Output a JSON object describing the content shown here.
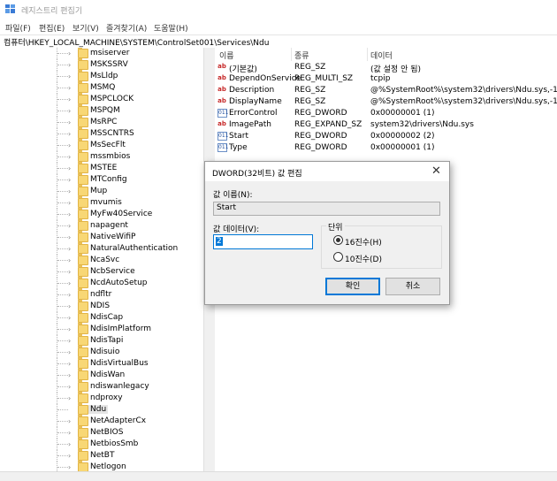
{
  "window": {
    "title": "레지스트리 편집기"
  },
  "menu": [
    "파일(F)",
    "편집(E)",
    "보기(V)",
    "즐겨찾기(A)",
    "도움말(H)"
  ],
  "address": "컴퓨터\\HKEY_LOCAL_MACHINE\\SYSTEM\\ControlSet001\\Services\\Ndu",
  "tree": {
    "items": [
      "msiserver",
      "MSKSSRV",
      "MsLldp",
      "MSMQ",
      "MSPCLOCK",
      "MSPQM",
      "MsRPC",
      "MSSCNTRS",
      "MsSecFlt",
      "mssmbios",
      "MSTEE",
      "MTConfig",
      "Mup",
      "mvumis",
      "MyFw40Service",
      "napagent",
      "NativeWifiP",
      "NaturalAuthentication",
      "NcaSvc",
      "NcbService",
      "NcdAutoSetup",
      "ndfltr",
      "NDIS",
      "NdisCap",
      "NdisImPlatform",
      "NdisTapi",
      "Ndisuio",
      "NdisVirtualBus",
      "NdisWan",
      "ndiswanlegacy",
      "ndproxy",
      "Ndu",
      "NetAdapterCx",
      "NetBIOS",
      "NetbiosSmb",
      "NetBT",
      "Netlogon"
    ],
    "selected": "Ndu"
  },
  "list": {
    "headers": {
      "name": "이름",
      "type": "종류",
      "data": "데이터"
    },
    "rows": [
      {
        "icon": "ab",
        "name": "(기본값)",
        "type": "REG_SZ",
        "data": "(값 설정 안 됨)"
      },
      {
        "icon": "ab",
        "name": "DependOnService",
        "type": "REG_MULTI_SZ",
        "data": "tcpip"
      },
      {
        "icon": "ab",
        "name": "Description",
        "type": "REG_SZ",
        "data": "@%SystemRoot%\\system32\\drivers\\Ndu.sys,-1..."
      },
      {
        "icon": "ab",
        "name": "DisplayName",
        "type": "REG_SZ",
        "data": "@%SystemRoot%\\system32\\drivers\\Ndu.sys,-1..."
      },
      {
        "icon": "011",
        "name": "ErrorControl",
        "type": "REG_DWORD",
        "data": "0x00000001 (1)"
      },
      {
        "icon": "ab",
        "name": "ImagePath",
        "type": "REG_EXPAND_SZ",
        "data": "system32\\drivers\\Ndu.sys"
      },
      {
        "icon": "011",
        "name": "Start",
        "type": "REG_DWORD",
        "data": "0x00000002 (2)"
      },
      {
        "icon": "011",
        "name": "Type",
        "type": "REG_DWORD",
        "data": "0x00000001 (1)"
      }
    ]
  },
  "dialog": {
    "title": "DWORD(32비트) 값 편집",
    "close": "✕",
    "value_name_label": "값 이름(N):",
    "value_name": "Start",
    "value_data_label": "값 데이터(V):",
    "value_data": "2",
    "base_label": "단위",
    "hex_label": "16진수(H)",
    "dec_label": "10진수(D)",
    "base_selected": "hex",
    "ok": "확인",
    "cancel": "취소"
  }
}
